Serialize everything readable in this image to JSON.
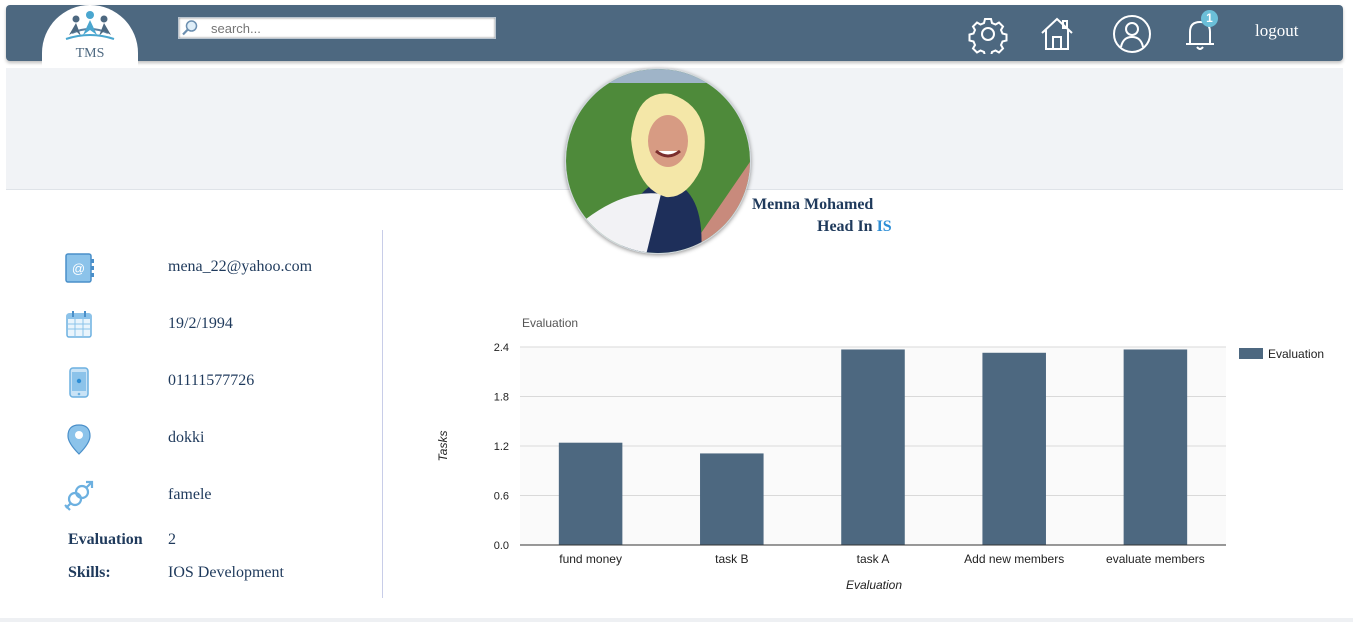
{
  "header": {
    "logo_text": "TMS",
    "search_placeholder": "search...",
    "logout_label": "logout",
    "notification_count": "1",
    "icons": [
      "settings-icon",
      "home-icon",
      "profile-icon",
      "notification-bell-icon"
    ]
  },
  "profile": {
    "name": "Menna Mohamed",
    "role_prefix": "Head In",
    "department": "IS"
  },
  "info": {
    "email": "mena_22@yahoo.com",
    "birthdate": "19/2/1994",
    "phone": "01111577726",
    "location": "dokki",
    "gender": "famele",
    "evaluation_label": "Evaluation",
    "evaluation_value": "2",
    "skills_label": "Skills:",
    "skills_value": "IOS Development"
  },
  "colors": {
    "header_bg": "#4d6880",
    "bar_color": "#4d6880",
    "text_dark_blue": "#1f3a5c",
    "accent_blue": "#2d8ed6"
  },
  "chart_data": {
    "type": "bar",
    "title": "Evaluation",
    "xlabel": "Evaluation",
    "ylabel": "Tasks",
    "categories": [
      "fund money",
      "task B",
      "task A",
      "Add new members",
      "evaluate members"
    ],
    "series": [
      {
        "name": "Evaluation",
        "values": [
          1.24,
          1.11,
          2.37,
          2.33,
          2.37
        ]
      }
    ],
    "yticks": [
      "0.0",
      "0.6",
      "1.2",
      "1.8",
      "2.4"
    ],
    "ylim": [
      0,
      2.4
    ],
    "grid": true,
    "legend": "right"
  }
}
